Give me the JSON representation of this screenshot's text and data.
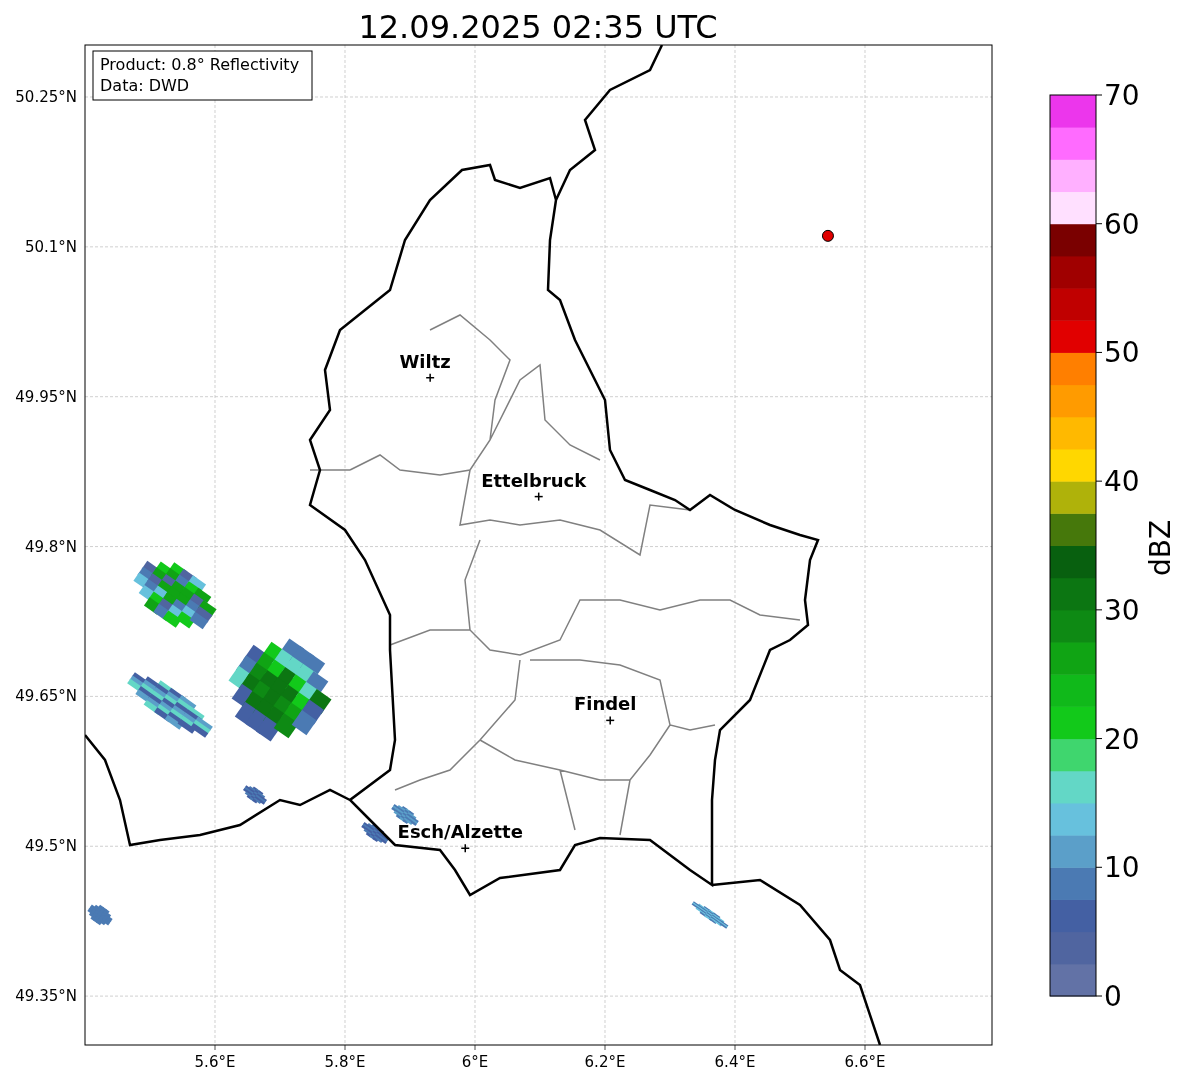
{
  "title": "12.09.2025 02:35 UTC",
  "info_box": [
    "Product: 0.8° Reflectivity",
    "Data: DWD"
  ],
  "map": {
    "xticks": [
      "5.6°E",
      "5.8°E",
      "6°E",
      "6.2°E",
      "6.4°E",
      "6.6°E"
    ],
    "yticks": [
      "50.25°N",
      "50.1°N",
      "49.95°N",
      "49.8°N",
      "49.65°N",
      "49.5°N",
      "49.35°N"
    ],
    "cities": [
      {
        "name": "Wiltz"
      },
      {
        "name": "Ettelbruck"
      },
      {
        "name": "Findel"
      },
      {
        "name": "Esch/Alzette"
      }
    ]
  },
  "colorbar": {
    "label": "dBZ",
    "ticks": [
      "70",
      "60",
      "50",
      "40",
      "30",
      "20",
      "10",
      "0"
    ],
    "bins": [
      {
        "color": "#6272a6"
      },
      {
        "color": "#5065a0"
      },
      {
        "color": "#4460a3"
      },
      {
        "color": "#4b7ab3"
      },
      {
        "color": "#5b9fc9"
      },
      {
        "color": "#67c1dd"
      },
      {
        "color": "#63d7c6"
      },
      {
        "color": "#3fd66e"
      },
      {
        "color": "#12c91a"
      },
      {
        "color": "#10b91a"
      },
      {
        "color": "#10a414"
      },
      {
        "color": "#0e8a14"
      },
      {
        "color": "#0c7612"
      },
      {
        "color": "#08600f"
      },
      {
        "color": "#46780b"
      },
      {
        "color": "#afb20a"
      },
      {
        "color": "#ffd700"
      },
      {
        "color": "#ffb900"
      },
      {
        "color": "#ff9b00"
      },
      {
        "color": "#ff7f00"
      },
      {
        "color": "#e10000"
      },
      {
        "color": "#c00000"
      },
      {
        "color": "#a00000"
      },
      {
        "color": "#7a0000"
      },
      {
        "color": "#ffe0ff"
      },
      {
        "color": "#ffb0ff"
      },
      {
        "color": "#ff6bff"
      },
      {
        "color": "#ec36ec"
      }
    ]
  }
}
